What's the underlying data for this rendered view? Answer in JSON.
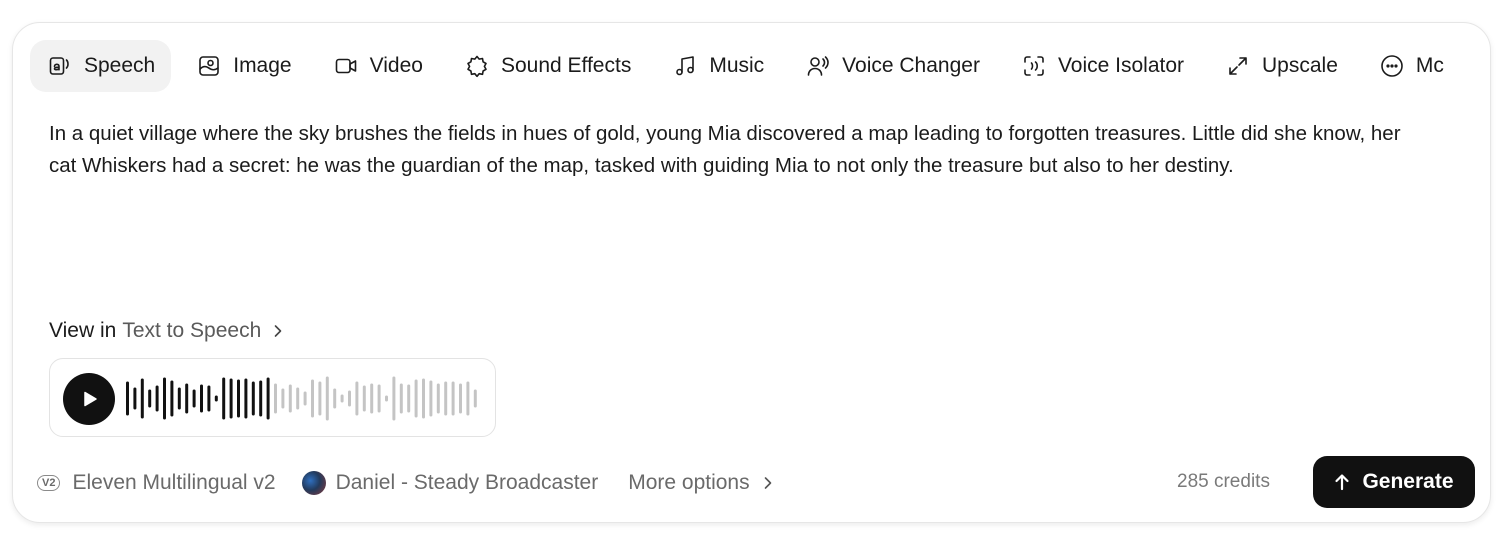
{
  "tabs": [
    {
      "label": "Speech",
      "icon": "speech-icon",
      "active": true
    },
    {
      "label": "Image",
      "icon": "image-icon"
    },
    {
      "label": "Video",
      "icon": "video-camera-icon"
    },
    {
      "label": "Sound Effects",
      "icon": "sound-effects-icon"
    },
    {
      "label": "Music",
      "icon": "music-note-icon"
    },
    {
      "label": "Voice Changer",
      "icon": "voice-changer-icon"
    },
    {
      "label": "Voice Isolator",
      "icon": "voice-isolator-icon"
    },
    {
      "label": "Upscale",
      "icon": "upscale-arrows-icon"
    },
    {
      "label": "Mc",
      "icon": "more-dots-icon"
    }
  ],
  "story_text": "In a quiet village where the sky brushes the fields in hues of gold, young Mia discovered a map leading to forgotten treasures. Little did she know, her cat Whiskers had a secret: he was the guardian of the map, tasked with guiding Mia to not only the treasure but also to her destiny.",
  "view_link": {
    "prefix": "View in",
    "target": "Text to Speech"
  },
  "player": {
    "progress": 0.41
  },
  "footer": {
    "model_badge": "V2",
    "model_name": "Eleven Multilingual v2",
    "voice_name": "Daniel - Steady Broadcaster",
    "more_options": "More options",
    "credits": "285 credits",
    "generate_label": "Generate"
  },
  "colors": {
    "accent": "#111111",
    "muted": "#6a6a6a",
    "wave_inactive": "#c4c4c4"
  }
}
